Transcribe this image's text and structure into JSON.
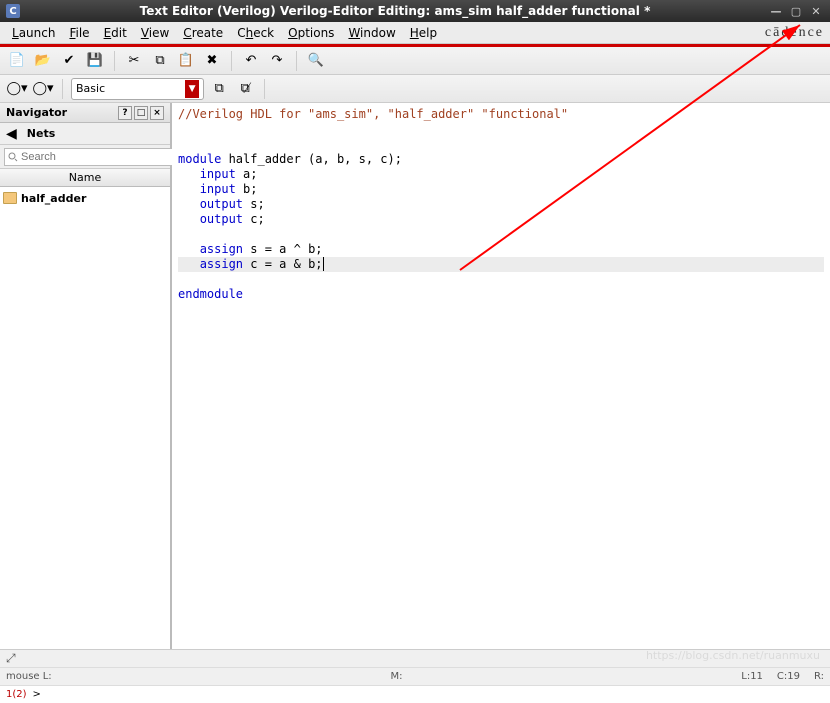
{
  "title": "Text Editor (Verilog) Verilog-Editor Editing: ams_sim half_adder functional *",
  "app_icon": "C",
  "menubar": [
    "Launch",
    "File",
    "Edit",
    "View",
    "Create",
    "Check",
    "Options",
    "Window",
    "Help"
  ],
  "menubar_underline_idx": [
    0,
    0,
    0,
    0,
    0,
    1,
    0,
    0,
    0
  ],
  "brand": "cādence",
  "toolbar2": {
    "select_value": "Basic"
  },
  "navigator": {
    "title": "Navigator",
    "tab": "Nets",
    "search_placeholder": "Search",
    "col_header": "Name",
    "items": [
      {
        "label": "half_adder"
      }
    ]
  },
  "code_lines": [
    {
      "t": "comment",
      "text": "//Verilog HDL for \"ams_sim\", \"half_adder\" \"functional\""
    },
    {
      "t": "blank",
      "text": ""
    },
    {
      "t": "blank",
      "text": ""
    },
    {
      "t": "module",
      "prefix": "module",
      "text": " half_adder (a, b, s, c);"
    },
    {
      "t": "decl",
      "kw": "input",
      "text": " a;"
    },
    {
      "t": "decl",
      "kw": "input",
      "text": " b;"
    },
    {
      "t": "decl",
      "kw": "output",
      "text": " s;"
    },
    {
      "t": "decl",
      "kw": "output",
      "text": " c;"
    },
    {
      "t": "blank",
      "text": ""
    },
    {
      "t": "assign",
      "kw": "assign",
      "text": " s = a ^ b;"
    },
    {
      "t": "assign",
      "kw": "assign",
      "text": " c = a & b;",
      "cursor": true
    },
    {
      "t": "blank",
      "text": ""
    },
    {
      "t": "end",
      "kw": "endmodule",
      "text": ""
    }
  ],
  "status": {
    "mouse": "mouse L:",
    "mid": "M:",
    "right": "R:",
    "line": "L:11",
    "col": "C:19",
    "page": "1(2)",
    "prompt": ">"
  },
  "watermark": "https://blog.csdn.net/ruanmuxu"
}
